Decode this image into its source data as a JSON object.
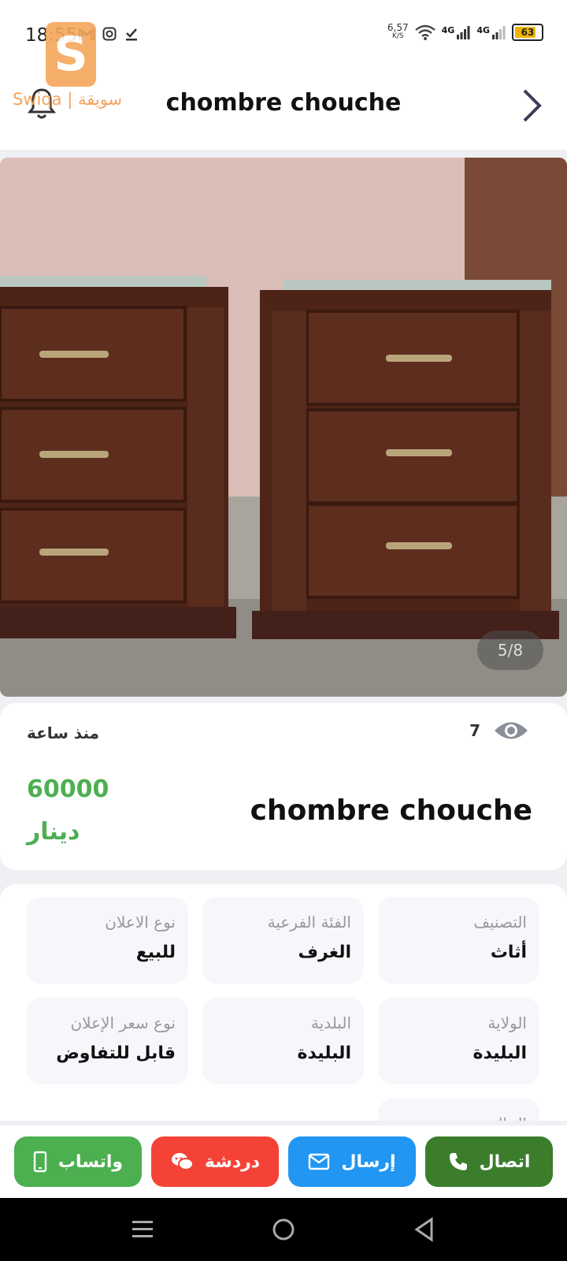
{
  "status_bar": {
    "time": "18:55",
    "net_speed": "6,57",
    "net_unit": "K/S",
    "signal_1": "4G",
    "signal_2": "4G",
    "battery": "63"
  },
  "logo": {
    "text": "Swiqa | سويقة"
  },
  "header": {
    "title": "chombre chouche"
  },
  "gallery": {
    "counter": "5/8"
  },
  "listing": {
    "since": "منذ ساعة",
    "views": "7",
    "price": "60000",
    "currency": "دينار",
    "title": "chombre chouche"
  },
  "details": [
    {
      "label": "التصنيف",
      "value": "أثاث"
    },
    {
      "label": "الفئة الفرعية",
      "value": "الغرف"
    },
    {
      "label": "نوع الاعلان",
      "value": "للبيع"
    },
    {
      "label": "الولاية",
      "value": "البليدة"
    },
    {
      "label": "البلدية",
      "value": "البليدة"
    },
    {
      "label": "نوع سعر الإعلان",
      "value": "قابل للتفاوض"
    },
    {
      "label": "الحالة",
      "value": ""
    }
  ],
  "actions": {
    "call": "اتصال",
    "send": "إرسال",
    "chat": "دردشة",
    "whatsapp": "واتساب"
  },
  "colors": {
    "call": "#3b7d2b",
    "send": "#2196f3",
    "chat": "#f44336",
    "whatsapp": "#4caf50",
    "price": "#4caf50"
  }
}
